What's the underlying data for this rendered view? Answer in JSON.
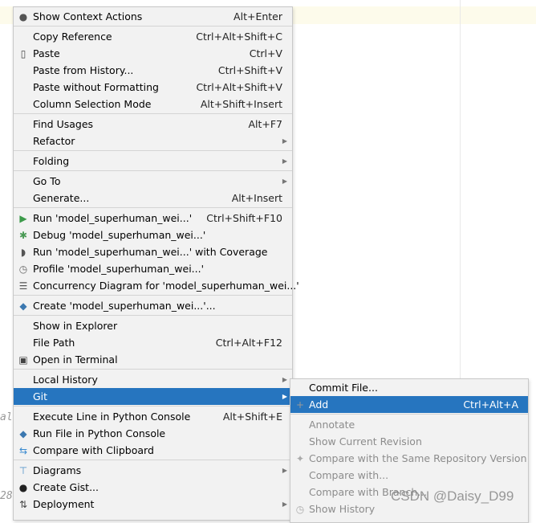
{
  "editor": {
    "gutter_text_1": "al",
    "gutter_text_2": "28"
  },
  "context_menu": {
    "items": [
      {
        "label": "Show Context Actions",
        "shortcut": "Alt+Enter",
        "icon": "lightbulb-icon"
      },
      {
        "sep": true
      },
      {
        "label": "Copy Reference",
        "shortcut": "Ctrl+Alt+Shift+C"
      },
      {
        "label": "Paste",
        "shortcut": "Ctrl+V",
        "icon": "clipboard-icon"
      },
      {
        "label": "Paste from History...",
        "shortcut": "Ctrl+Shift+V"
      },
      {
        "label": "Paste without Formatting",
        "shortcut": "Ctrl+Alt+Shift+V"
      },
      {
        "label": "Column Selection Mode",
        "shortcut": "Alt+Shift+Insert"
      },
      {
        "sep": true
      },
      {
        "label": "Find Usages",
        "shortcut": "Alt+F7"
      },
      {
        "label": "Refactor",
        "submenu": true
      },
      {
        "sep": true
      },
      {
        "label": "Folding",
        "submenu": true
      },
      {
        "sep": true
      },
      {
        "label": "Go To",
        "submenu": true
      },
      {
        "label": "Generate...",
        "shortcut": "Alt+Insert"
      },
      {
        "sep": true
      },
      {
        "label": "Run 'model_superhuman_wei...'",
        "shortcut": "Ctrl+Shift+F10",
        "icon": "run-icon"
      },
      {
        "label": "Debug 'model_superhuman_wei...'",
        "icon": "debug-icon"
      },
      {
        "label": "Run 'model_superhuman_wei...' with Coverage",
        "icon": "coverage-icon"
      },
      {
        "label": "Profile 'model_superhuman_wei...'",
        "icon": "profile-icon"
      },
      {
        "label": "Concurrency Diagram for 'model_superhuman_wei...'",
        "icon": "concurrency-icon"
      },
      {
        "sep": true
      },
      {
        "label": "Create 'model_superhuman_wei...'...",
        "icon": "python-icon"
      },
      {
        "sep": true
      },
      {
        "label": "Show in Explorer"
      },
      {
        "label": "File Path",
        "shortcut": "Ctrl+Alt+F12"
      },
      {
        "label": "Open in Terminal",
        "icon": "terminal-icon"
      },
      {
        "sep": true
      },
      {
        "label": "Local History",
        "submenu": true
      },
      {
        "label": "Git",
        "submenu": true,
        "selected": true
      },
      {
        "sep": true
      },
      {
        "label": "Execute Line in Python Console",
        "shortcut": "Alt+Shift+E"
      },
      {
        "label": "Run File in Python Console",
        "icon": "python-icon"
      },
      {
        "label": "Compare with Clipboard",
        "icon": "compare-clipboard-icon"
      },
      {
        "sep": true
      },
      {
        "label": "Diagrams",
        "submenu": true,
        "icon": "diagram-icon"
      },
      {
        "label": "Create Gist...",
        "icon": "github-icon"
      },
      {
        "label": "Deployment",
        "submenu": true,
        "icon": "deployment-icon"
      }
    ]
  },
  "git_submenu": {
    "items": [
      {
        "label": "Commit File..."
      },
      {
        "label": "Add",
        "shortcut": "Ctrl+Alt+A",
        "icon": "plus-icon",
        "selected": true
      },
      {
        "sep": true
      },
      {
        "label": "Annotate",
        "disabled": true
      },
      {
        "label": "Show Current Revision",
        "disabled": true
      },
      {
        "label": "Compare with the Same Repository Version",
        "disabled": true,
        "icon": "compare-icon"
      },
      {
        "label": "Compare with...",
        "disabled": true
      },
      {
        "label": "Compare with Branch...",
        "disabled": true
      },
      {
        "label": "Show History",
        "disabled": true,
        "icon": "clock-icon"
      }
    ]
  },
  "watermark": "CSDN @Daisy_D99",
  "colors": {
    "selection": "#2675bf",
    "menu_bg": "#f2f2f2",
    "disabled": "#8c8c8c"
  }
}
